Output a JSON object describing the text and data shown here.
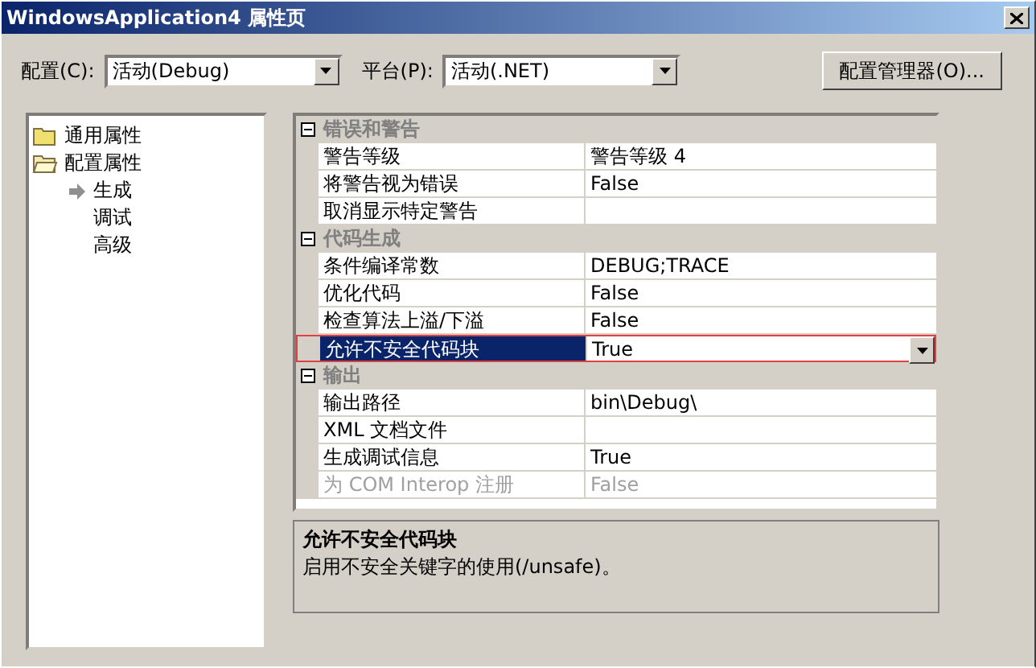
{
  "window": {
    "title": "WindowsApplication4 属性页"
  },
  "toolbar": {
    "config_label": "配置(C):",
    "config_value": "活动(Debug)",
    "platform_label": "平台(P):",
    "platform_value": "活动(.NET)",
    "manager_button": "配置管理器(O)..."
  },
  "tree": [
    {
      "label": "通用属性",
      "kind": "folder",
      "expanded": false
    },
    {
      "label": "配置属性",
      "kind": "folder",
      "expanded": true,
      "children": [
        {
          "label": "生成",
          "selected": true
        },
        {
          "label": "调试",
          "selected": false
        },
        {
          "label": "高级",
          "selected": false
        }
      ]
    }
  ],
  "property_grid": [
    {
      "category": "错误和警告",
      "expanded": true,
      "rows": [
        {
          "name": "警告等级",
          "value": "警告等级 4",
          "selected": false,
          "disabled": false
        },
        {
          "name": "将警告视为错误",
          "value": "False",
          "selected": false,
          "disabled": false
        },
        {
          "name": "取消显示特定警告",
          "selected": false,
          "disabled": false
        }
      ]
    },
    {
      "category": "代码生成",
      "expanded": true,
      "rows": [
        {
          "name": "条件编译常数",
          "value": "DEBUG;TRACE",
          "selected": false,
          "disabled": false
        },
        {
          "name": "优化代码",
          "value": "False",
          "selected": false,
          "disabled": false
        },
        {
          "name": "检查算法上溢/下溢",
          "value": "False",
          "selected": false,
          "disabled": false
        },
        {
          "name": "允许不安全代码块",
          "value": "True",
          "selected": true,
          "disabled": false
        }
      ]
    },
    {
      "category": "输出",
      "expanded": true,
      "rows": [
        {
          "name": "输出路径",
          "value": "bin\\Debug\\",
          "selected": false,
          "disabled": false
        },
        {
          "name": "XML 文档文件",
          "selected": false,
          "disabled": false
        },
        {
          "name": "生成调试信息",
          "value": "True",
          "selected": false,
          "disabled": false
        },
        {
          "name": "为 COM Interop 注册",
          "value": "False",
          "selected": false,
          "disabled": true
        }
      ]
    }
  ],
  "description": {
    "title": "允许不安全代码块",
    "text": "启用不安全关键字的使用(/unsafe)。"
  }
}
